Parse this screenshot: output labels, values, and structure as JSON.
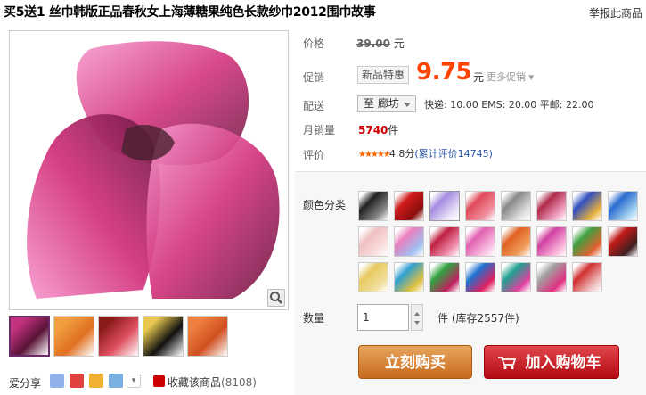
{
  "product": {
    "title": "买5送1 丝巾韩版正品春秋女上海薄糖果纯色长款纱巾2012围巾故事",
    "report_link": "举报此商品"
  },
  "gallery": {
    "zoom_icon": "magnifier-icon",
    "thumb_colors": [
      [
        "#c4327f",
        "#5a1438"
      ],
      [
        "#f0a040",
        "#e07020"
      ],
      [
        "#8a1a1a",
        "#e05060"
      ],
      [
        "#e8c850",
        "#111111"
      ],
      [
        "#f08040",
        "#d05020"
      ]
    ],
    "main_colors": [
      "#f79ccf",
      "#d3357d",
      "#6a1a44",
      "#4a2030"
    ]
  },
  "share": {
    "label": "爱分享",
    "fav_label": "收藏该商品",
    "fav_count": "(8108)",
    "icon_colors": [
      "#8fb3e8",
      "#e04040",
      "#f0b030",
      "#7ab0e0"
    ]
  },
  "info": {
    "price_label": "价格",
    "orig_price": "39.00",
    "yuan": "元",
    "promo_label": "促销",
    "promo_badge": "新品特惠",
    "promo_price": "9.75",
    "more_promos": "更多促销",
    "ship_label": "配送",
    "ship_dest": "至 廊坊",
    "ship_text": "快递: 10.00 EMS: 20.00 平邮: 22.00",
    "sales_label": "月销量",
    "sales_count": "5740",
    "sales_unit": "件",
    "rating_label": "评价",
    "stars": "★★★★★",
    "rating_score": "4.8分",
    "rating_link": "(累计评价14745)"
  },
  "sku": {
    "label": "颜色分类",
    "swatches": [
      [
        "#222222",
        "#888888"
      ],
      [
        "#d01a1a",
        "#8a0e0e"
      ],
      [
        "#a58be0",
        "#e8e0f8"
      ],
      [
        "#e04a5a",
        "#f090a0"
      ],
      [
        "#888888",
        "#dddddd"
      ],
      [
        "#b02a4a",
        "#f0a0c0"
      ],
      [
        "#3050c0",
        "#e8b040"
      ],
      [
        "#2a6ad0",
        "#a0d0f0"
      ],
      [
        "#f0c0c0",
        "#f8e0e0"
      ],
      [
        "#e880c0",
        "#a0c0f0"
      ],
      [
        "#c02040",
        "#f090b0"
      ],
      [
        "#e060b0",
        "#f8c0e0"
      ],
      [
        "#e06020",
        "#f0a060"
      ],
      [
        "#d040a0",
        "#f8b0d8"
      ],
      [
        "#40a040",
        "#e06030"
      ],
      [
        "#c01a1a",
        "#402020"
      ],
      [
        "#e8c860",
        "#f0e0a0"
      ],
      [
        "#30a0d0",
        "#e0c040"
      ],
      [
        "#30a040",
        "#c02060"
      ],
      [
        "#2070d0",
        "#e02060"
      ],
      [
        "#20a090",
        "#e040a0"
      ],
      [
        "#a0a0a0",
        "#e03080"
      ],
      [
        "#d03030",
        "#f0c0c0"
      ]
    ],
    "qty_label": "数量",
    "qty_value": "1",
    "qty_unit": "件 (库存2557件)",
    "buy_label": "立刻购买",
    "cart_label": "加入购物车"
  }
}
